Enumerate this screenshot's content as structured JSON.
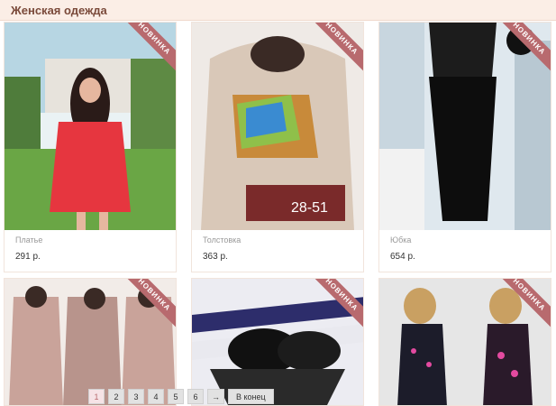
{
  "header": {
    "title": "Женская одежда"
  },
  "products": [
    {
      "name": "Платье",
      "price": "291 р.",
      "badge": "НОВИНКА"
    },
    {
      "name": "Толстовка",
      "price": "363 р.",
      "badge": "НОВИНКА",
      "image_text": "28-51"
    },
    {
      "name": "Юбка",
      "price": "654 р.",
      "badge": "НОВИНКА"
    },
    {
      "badge": "НОВИНКА"
    },
    {
      "badge": "НОВИНКА"
    },
    {
      "badge": "НОВИНКА"
    }
  ],
  "pagination": {
    "pages": [
      "1",
      "2",
      "3",
      "4",
      "5",
      "6"
    ],
    "next": "→",
    "last": "В конец",
    "active": "1"
  }
}
